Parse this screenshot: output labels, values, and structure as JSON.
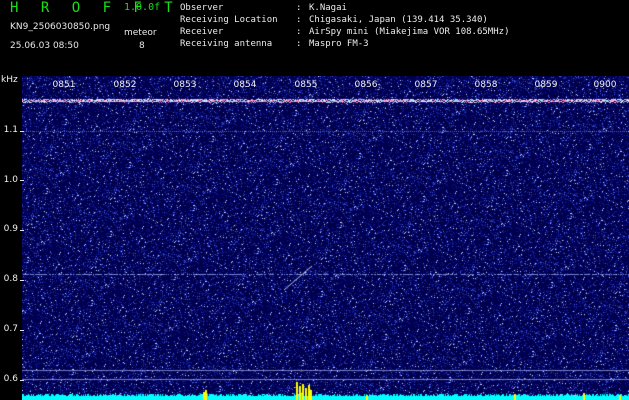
{
  "app": {
    "name": "H R O F F T",
    "version": "1.0.0f",
    "file_name": "KN9_2506030850.png",
    "datetime": "25.06.03 08:50",
    "meteor_label": "meteor",
    "meteor_count": "8"
  },
  "info": [
    {
      "label": "Observer",
      "value": "K.Nagai"
    },
    {
      "label": "Receiving Location",
      "value": "Chigasaki, Japan (139.414 35.340)"
    },
    {
      "label": "Receiver",
      "value": "AirSpy mini (Miakejima VOR 108.65MHz)"
    },
    {
      "label": "Receiving antenna",
      "value": "Maspro FM-3"
    }
  ],
  "colon": ":",
  "spectrogram": {
    "unit_label": "kHz",
    "time_labels": [
      "0851",
      "0852",
      "0853",
      "0854",
      "0855",
      "0856",
      "0857",
      "0858",
      "0859",
      "0900"
    ],
    "freq_labels": [
      "1.1",
      "1.0",
      "0.9",
      "0.8",
      "0.7",
      "0.6"
    ],
    "freq_range_khz": [
      0.57,
      1.19
    ],
    "colors": {
      "background": "#000050",
      "noise_low": "#1a1aa0",
      "noise_high": "#ffffff",
      "carrier": "#ff7ab0",
      "baseline": "#00ffff",
      "burst": "#ffff00"
    }
  }
}
